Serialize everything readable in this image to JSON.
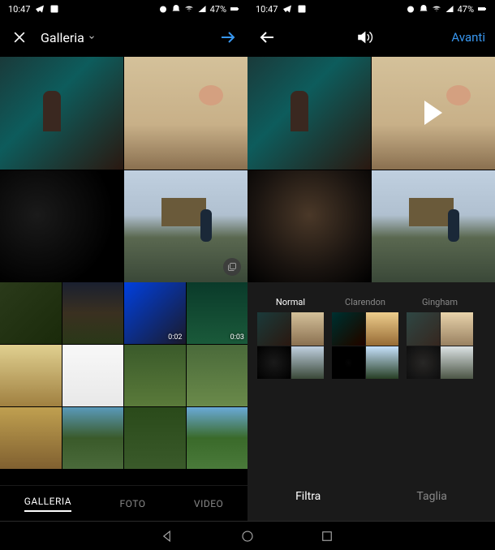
{
  "status": {
    "time": "10:47",
    "battery": "47%"
  },
  "left": {
    "title": "Galleria",
    "thumb_durations": {
      "t3": "0:02",
      "t4": "0:03"
    },
    "tabs": {
      "gallery": "GALLERIA",
      "photo": "FOTO",
      "video": "VIDEO"
    }
  },
  "right": {
    "next_label": "Avanti",
    "filters": {
      "normal": "Normal",
      "clarendon": "Clarendon",
      "gingham": "Gingham"
    },
    "edit_tabs": {
      "filter": "Filtra",
      "crop": "Taglia"
    }
  }
}
